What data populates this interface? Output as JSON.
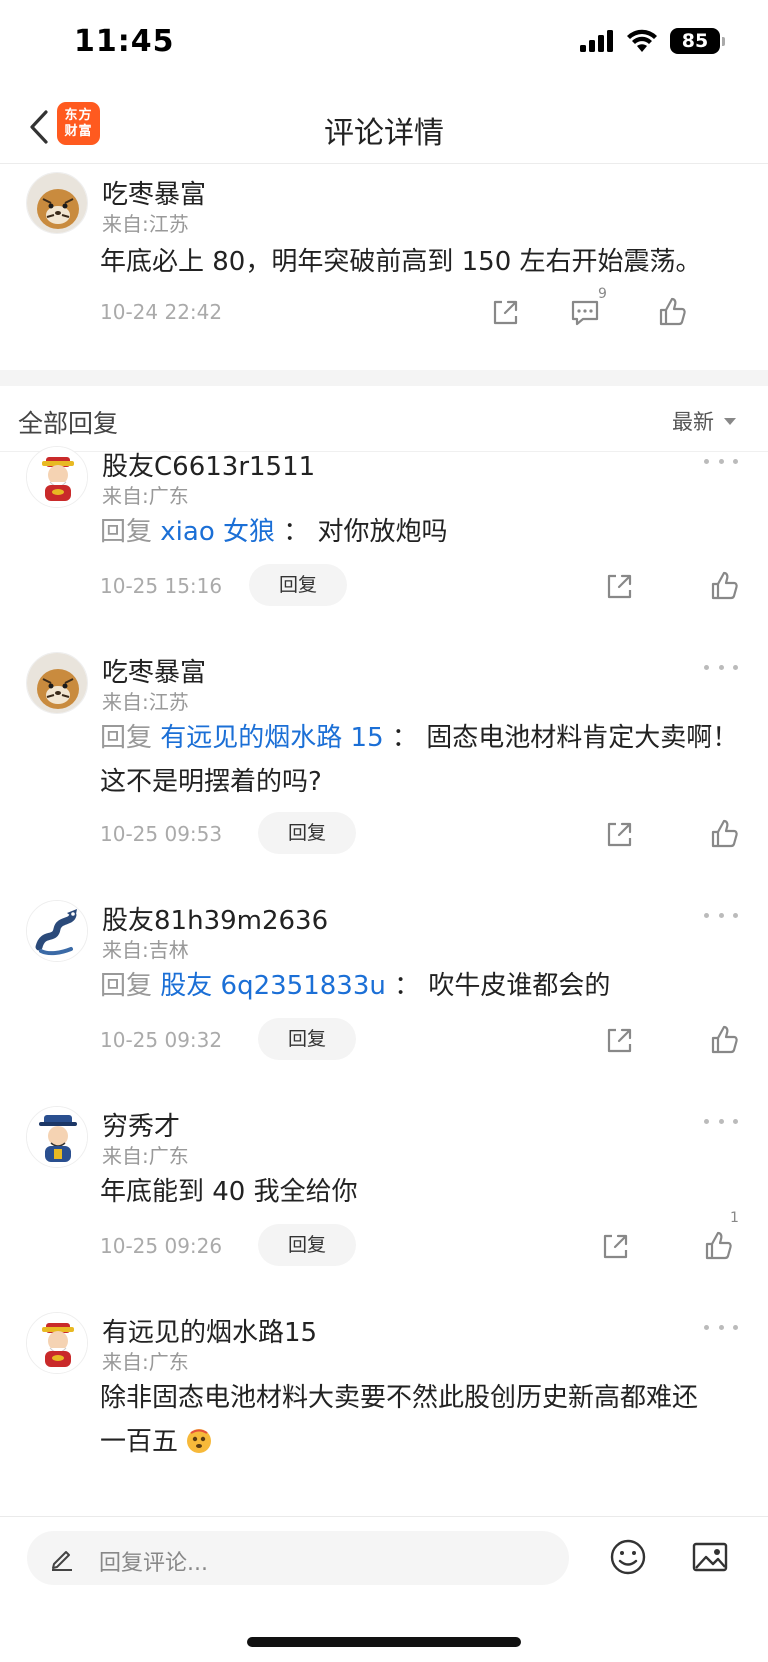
{
  "status_bar": {
    "time": "11:45",
    "battery": "85"
  },
  "nav": {
    "title": "评论详情",
    "logo_line1": "东方",
    "logo_line2": "财富"
  },
  "main_comment": {
    "username": "吃枣暴富",
    "location": "来自:江苏",
    "content": "年底必上 80，明年突破前高到 150 左右开始震荡。",
    "timestamp": "10-24 22:42",
    "reply_count": "9"
  },
  "replies_section": {
    "title": "全部回复",
    "sort": "最新"
  },
  "replies": [
    {
      "username": "股友C6613r1511",
      "location": "来自:广东",
      "reply_prefix": "回复",
      "reply_target": "xiao 女狼",
      "separator": "：",
      "content": "对你放炮吗",
      "timestamp": "10-25 15:16",
      "reply_label": "回复"
    },
    {
      "username": "吃枣暴富",
      "location": "来自:江苏",
      "reply_prefix": "回复",
      "reply_target": "有远见的烟水路 15",
      "separator": "：",
      "content": "固态电池材料肯定大卖啊！",
      "content_line2": "这不是明摆着的吗?",
      "timestamp": "10-25 09:53",
      "reply_label": "回复"
    },
    {
      "username": "股友81h39m2636",
      "location": "来自:吉林",
      "reply_prefix": "回复",
      "reply_target": "股友 6q2351833u",
      "separator": "：",
      "content": "吹牛皮谁都会的",
      "timestamp": "10-25 09:32",
      "reply_label": "回复"
    },
    {
      "username": "穷秀才",
      "location": "来自:广东",
      "content": "年底能到 40 我全给你",
      "timestamp": "10-25 09:26",
      "reply_label": "回复",
      "like_count": "1"
    },
    {
      "username": "有远见的烟水路15",
      "location": "来自:广东",
      "content": "除非固态电池材料大卖要不然此股创历史新高都难还",
      "content_line2": "一百五"
    }
  ],
  "bottom_bar": {
    "placeholder": "回复评论..."
  },
  "colors": {
    "link": "#1b6fd6",
    "brand": "#ff5a1f",
    "muted": "#999999"
  }
}
